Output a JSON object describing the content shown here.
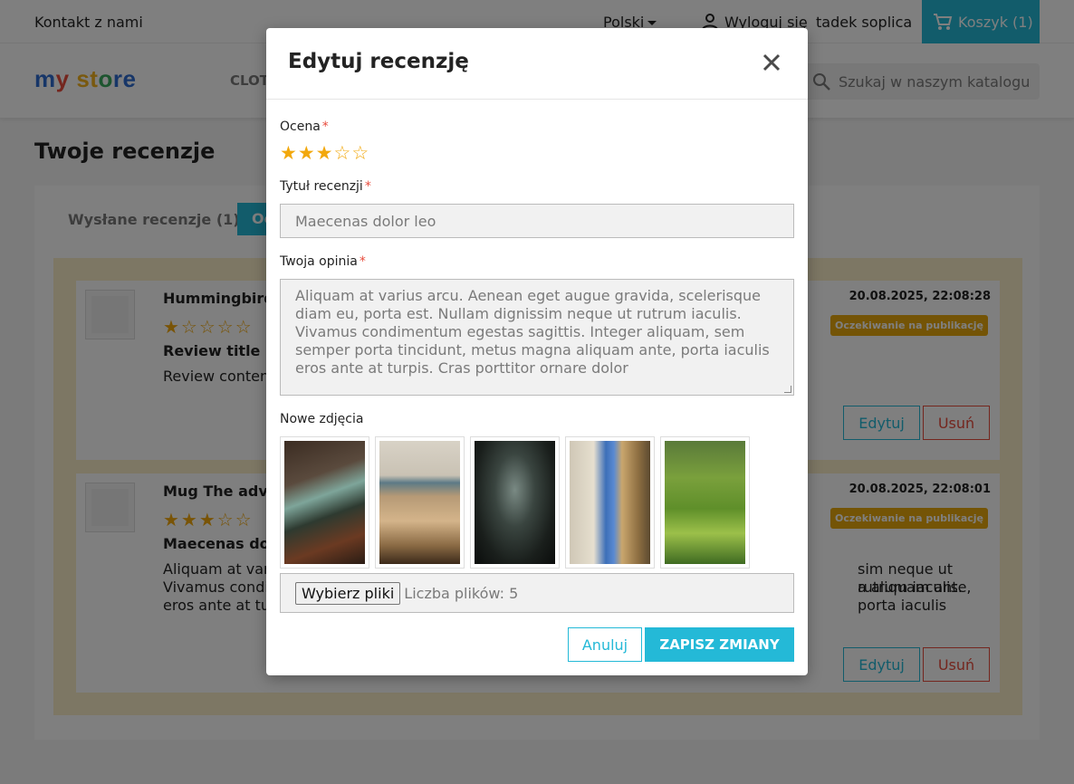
{
  "topbar": {
    "contact": "Kontakt z nami",
    "language": "Polski",
    "logout": "Wyloguj się",
    "username": "tadek soplica",
    "cart": "Koszyk (1)"
  },
  "navbar": {
    "logo_parts": [
      "m",
      "y",
      " st",
      "o",
      "re"
    ],
    "menu_first": "CLOT",
    "search_placeholder": "Szukaj w naszym katalogu"
  },
  "page": {
    "title": "Twoje recenzje",
    "tab_sent": "Wysłane recenzje (1)",
    "tab_active": "Oc"
  },
  "reviews": [
    {
      "product": "Hummingbird",
      "stars_text": "★☆☆☆☆",
      "title": "Review title 1",
      "content": "Review content",
      "date": "20.08.2025, 22:08:28",
      "status": "Oczekiwanie na publikację",
      "edit": "Edytuj",
      "delete": "Usuń"
    },
    {
      "product": "Mug The adver",
      "stars_text": "★★★☆☆",
      "title": "Maecenas dolo",
      "content_1": "Aliquam at variu",
      "content_right_1": "sim neque ut rutrum iaculis.",
      "content_2": "Vivamus condim",
      "content_right_2": "a aliquam ante, porta iaculis",
      "content_3": "eros ante at turp",
      "date": "20.08.2025, 22:08:01",
      "status": "Oczekiwanie na publikację",
      "edit": "Edytuj",
      "delete": "Usuń"
    }
  ],
  "modal": {
    "title": "Edytuj recenzję",
    "rating_label": "Ocena",
    "rating_value": 3,
    "rating_max": 5,
    "title_label": "Tytuł recenzji",
    "title_value": "Maecenas dolor leo",
    "opinion_label": "Twoja opinia",
    "opinion_value": "Aliquam at varius arcu. Aenean eget augue gravida, scelerisque diam eu, porta est. Nullam dignissim neque ut rutrum iaculis. Vivamus condimentum egestas sagittis. Integer aliquam, sem semper porta tincidunt, metus magna aliquam ante, porta iaculis eros ante at turpis. Cras porttitor ornare dolor",
    "photos_label": "Nowe zdjęcia",
    "photos": [
      "chair-leaves-photo",
      "beach-shore-photo",
      "dark-stairs-photo",
      "city-buildings-photo",
      "green-hills-photo"
    ],
    "file_button": "Wybierz pliki",
    "file_count": "Liczba plików: 5",
    "cancel": "Anuluj",
    "save": "ZAPISZ ZMIANY",
    "required_mark": "*"
  },
  "colors": {
    "accent": "#24b9d7",
    "danger": "#e84c3d",
    "star": "#f2a80c",
    "badge": "#e8a90d"
  }
}
